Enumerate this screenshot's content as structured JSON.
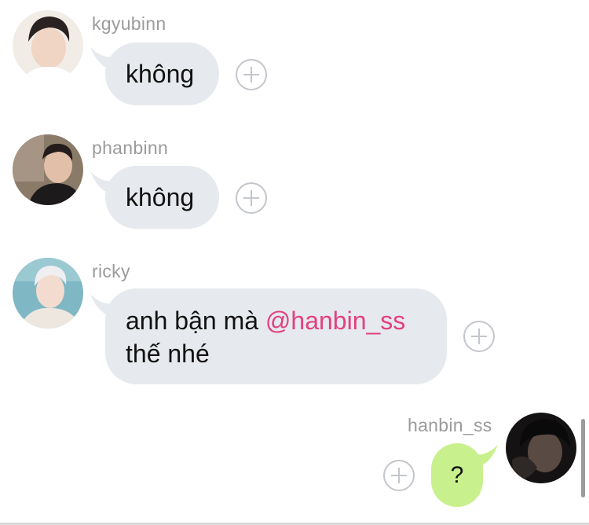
{
  "messages": [
    {
      "username": "kgyubinn",
      "text": "không",
      "avatar": "kgyubinn-avatar"
    },
    {
      "username": "phanbinn",
      "text": "không",
      "avatar": "phanbinn-avatar"
    },
    {
      "username": "ricky",
      "text_before": "anh bận mà ",
      "mention": "@hanbin_ss",
      "text_after": "thế nhé",
      "avatar": "ricky-avatar"
    },
    {
      "username": "hanbin_ss",
      "text": "?",
      "avatar": "hanbin-avatar"
    }
  ],
  "icons": {
    "react": "plus-circle-icon"
  },
  "colors": {
    "incoming_bubble": "#e6e9ed",
    "outgoing_bubble": "#c8f08c",
    "mention": "#e2417f",
    "username": "#9b9b9b"
  }
}
